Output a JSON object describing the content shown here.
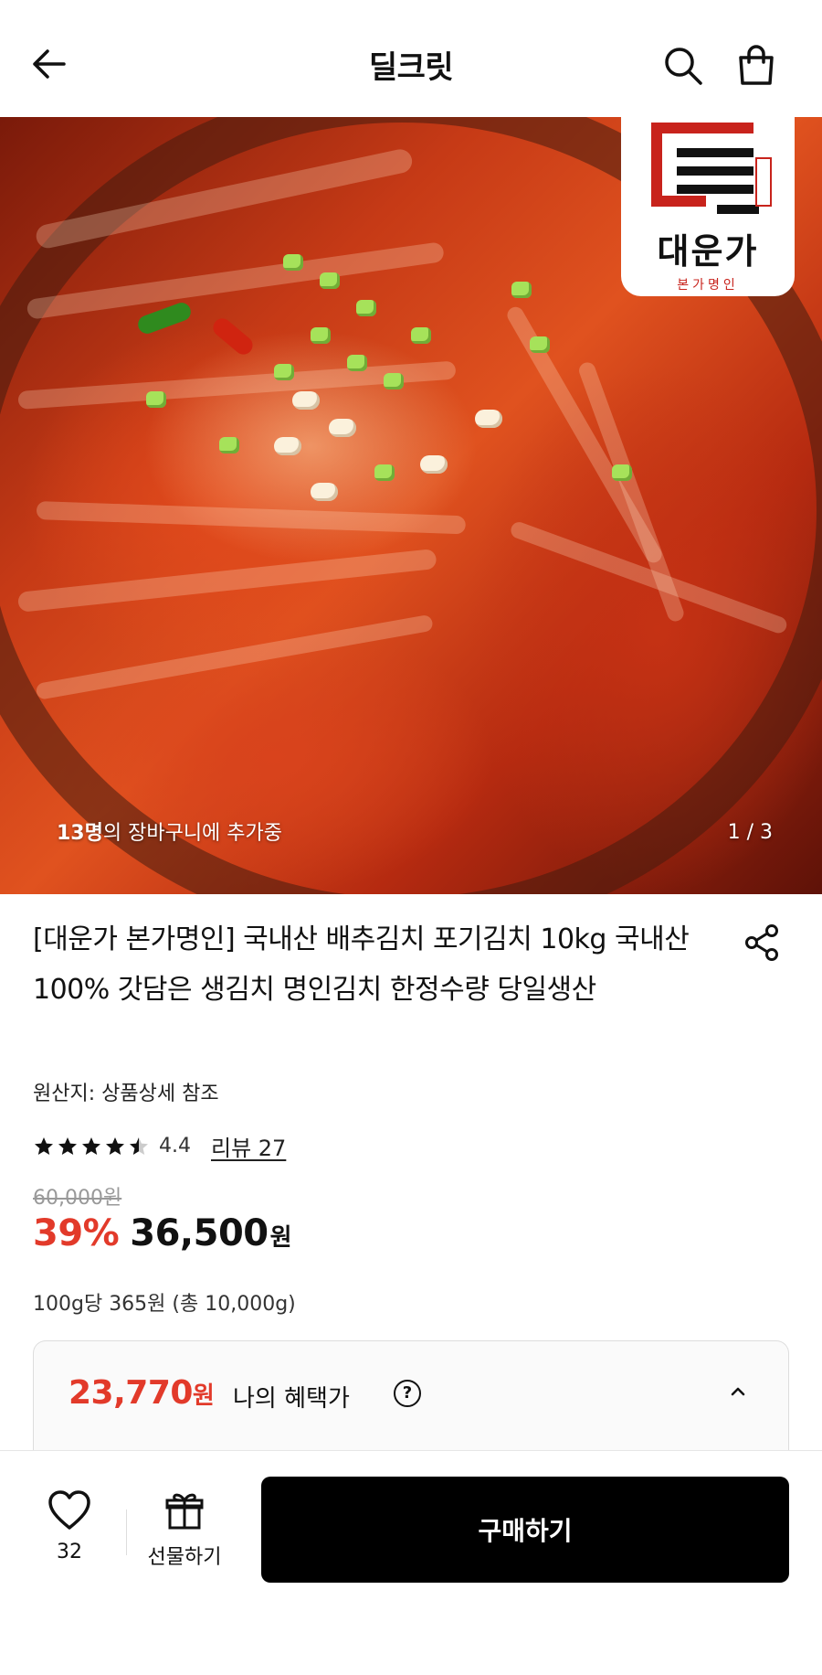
{
  "header": {
    "title": "딜크릿",
    "back_icon": "arrow-left-icon",
    "search_icon": "search-icon",
    "cart_icon": "shopping-bag-icon"
  },
  "hero": {
    "logo": {
      "name": "대운가",
      "subtitle": "본가명인"
    },
    "cart_count": "13명",
    "cart_text": "의 장바구니에 추가중",
    "counter": "1 / 3"
  },
  "product": {
    "title": "[대운가 본가명인] 국내산 배추김치 포기김치 10kg 국내산100% 갓담은 생김치 명인김치 한정수량 당일생산",
    "origin": "원산지: 상품상세 참조",
    "rating": {
      "value": 4.4,
      "score_label": "4.4",
      "review_label": "리뷰 27"
    },
    "original_price": "60,000원",
    "discount": "39%",
    "price": "36,500",
    "price_unit": "원",
    "unit_price": "100g당 365원 (총 10,000g)"
  },
  "benefit": {
    "price": "23,770",
    "price_unit": "원",
    "label": "나의 혜택가",
    "help": "?"
  },
  "bottom_bar": {
    "like_count": "32",
    "gift_label": "선물하기",
    "buy_label": "구매하기"
  },
  "colors": {
    "accent_red": "#e23a2a",
    "buy_button": "#000000"
  }
}
